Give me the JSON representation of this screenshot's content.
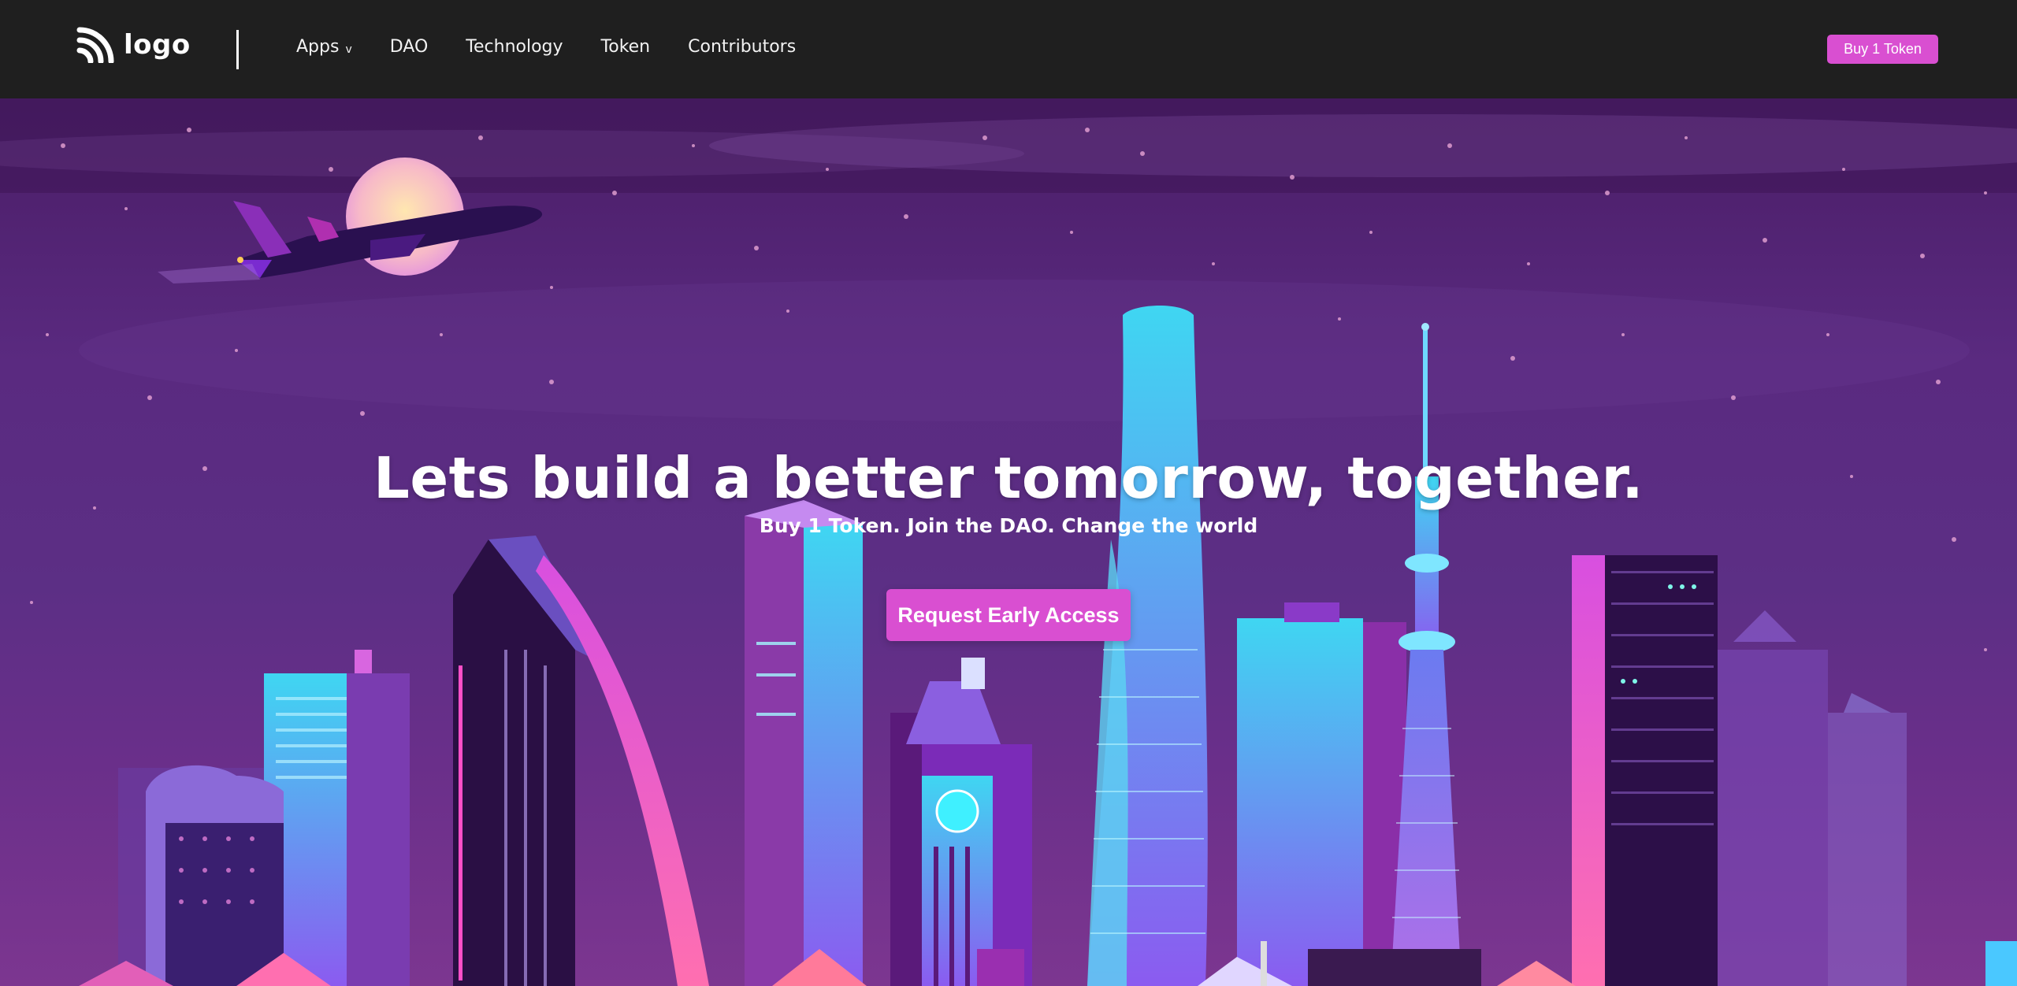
{
  "header": {
    "logo_text": "logo",
    "nav": [
      {
        "label": "Apps",
        "has_dropdown": true,
        "chevron": "v"
      },
      {
        "label": "DAO"
      },
      {
        "label": "Technology"
      },
      {
        "label": "Token"
      },
      {
        "label": "Contributors"
      }
    ],
    "buy_button_label": "Buy 1 Token"
  },
  "hero": {
    "headline": "Lets build a better tomorrow, together.",
    "subheadline": "Buy 1 Token. Join the DAO. Change the world",
    "cta_label": "Request Early Access"
  },
  "colors": {
    "topbar_bg": "#1f1f1f",
    "accent": "#d94fd1",
    "hero_sky": "#5a2a80"
  },
  "icons": {
    "logo": "rss-wave-icon",
    "dropdown": "chevron-down-icon"
  }
}
